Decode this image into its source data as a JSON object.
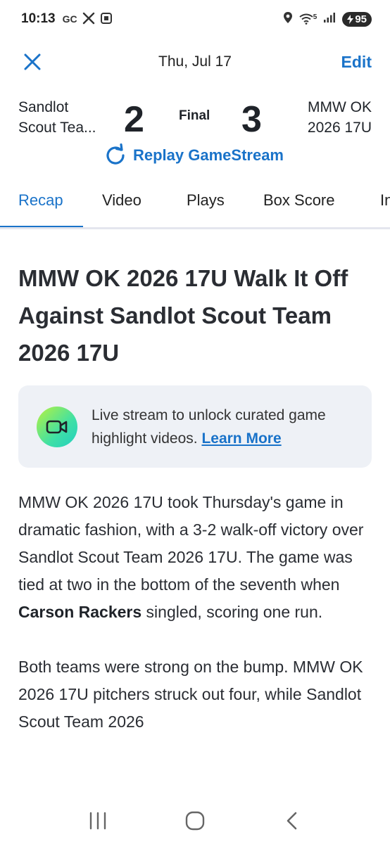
{
  "status_bar": {
    "time": "10:13",
    "left_icons": [
      "gc-icon",
      "x-icon",
      "screenshot-icon"
    ],
    "gc_label": "GC",
    "right_icons": [
      "location-icon",
      "wifi-icon",
      "signal-icon"
    ],
    "wifi_label": "5",
    "battery": "95"
  },
  "header": {
    "date": "Thu, Jul 17",
    "edit_label": "Edit"
  },
  "scoreboard": {
    "away_team_line1": "Sandlot",
    "away_team_line2": "Scout Tea...",
    "away_score": "2",
    "status": "Final",
    "home_score": "3",
    "home_team_line1": "MMW OK",
    "home_team_line2": "2026 17U"
  },
  "replay_label": "Replay GameStream",
  "tabs": [
    {
      "label": "Recap",
      "active": true
    },
    {
      "label": "Video",
      "active": false
    },
    {
      "label": "Plays",
      "active": false
    },
    {
      "label": "Box Score",
      "active": false
    },
    {
      "label": "In",
      "active": false
    }
  ],
  "article": {
    "headline": "MMW OK 2026 17U Walk It Off Against Sandlot Scout Team 2026 17U",
    "promo_text": "Live stream to unlock curated game highlight videos.",
    "promo_link": "Learn More",
    "para1_start": "MMW OK 2026 17U took Thursday's game in dramatic fashion, with a 3-2 walk-off victory over Sandlot Scout Team 2026 17U. The game was tied at two in the bottom of the seventh when ",
    "para1_player": "Carson Rackers",
    "para1_end": " singled, scoring one run.",
    "para2": "Both teams were strong on the bump. MMW OK 2026 17U pitchers struck out four, while Sandlot Scout Team 2026"
  },
  "colors": {
    "accent": "#1a73c9",
    "promo_bg": "#eef1f6",
    "text": "#2a2d33"
  }
}
